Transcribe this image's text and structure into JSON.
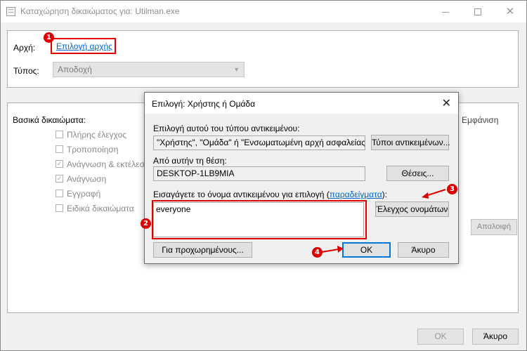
{
  "parent_window": {
    "title": "Καταχώρηση δικαιώματος για: Utilman.exe",
    "principal_label": "Αρχή:",
    "principal_link": "Επιλογή αρχής",
    "type_label": "Τύπος:",
    "type_value": "Αποδοχή",
    "basic_permissions_label": "Βασικά δικαιώματα:",
    "permissions": [
      {
        "label": "Πλήρης έλεγχος",
        "checked": false
      },
      {
        "label": "Τροποποίηση",
        "checked": false
      },
      {
        "label": "Ανάγνωση & εκτέλεση",
        "checked": true
      },
      {
        "label": "Ανάγνωση",
        "checked": true
      },
      {
        "label": "Εγγραφή",
        "checked": false
      },
      {
        "label": "Ειδικά δικαιώματα",
        "checked": false
      }
    ],
    "show_advanced_link": "Εμφάνιση",
    "clear_all_button": "Απαλοιφή",
    "ok_button": "OK",
    "cancel_button": "Άκυρο"
  },
  "dialog": {
    "title": "Επιλογή: Χρήστης ή Ομάδα",
    "object_types_label": "Επιλογή αυτού του τύπου αντικειμένου:",
    "object_types_value": "\"Χρήστης\", \"Ομάδα\" ή \"Ενσωματωμένη αρχή ασφαλείας\"",
    "object_types_button": "Τύποι αντικειμένων...",
    "location_label": "Από αυτήν τη θέση:",
    "location_value": "DESKTOP-1LB9MIA",
    "locations_button": "Θέσεις...",
    "enter_names_label": "Εισαγάγετε το όνομα αντικειμένου για επιλογή (",
    "examples_link": "παραδείγματα",
    "enter_names_label_end": "):",
    "object_name_value": "everyone",
    "check_names_button": "Έλεγχος ονομάτων",
    "advanced_button": "Για προχωρημένους...",
    "ok_button": "OK",
    "cancel_button": "Άκυρο"
  },
  "annotations": {
    "badge_1": "1",
    "badge_2": "2",
    "badge_3": "3",
    "badge_4": "4",
    "highlight_color": "#e00000"
  }
}
